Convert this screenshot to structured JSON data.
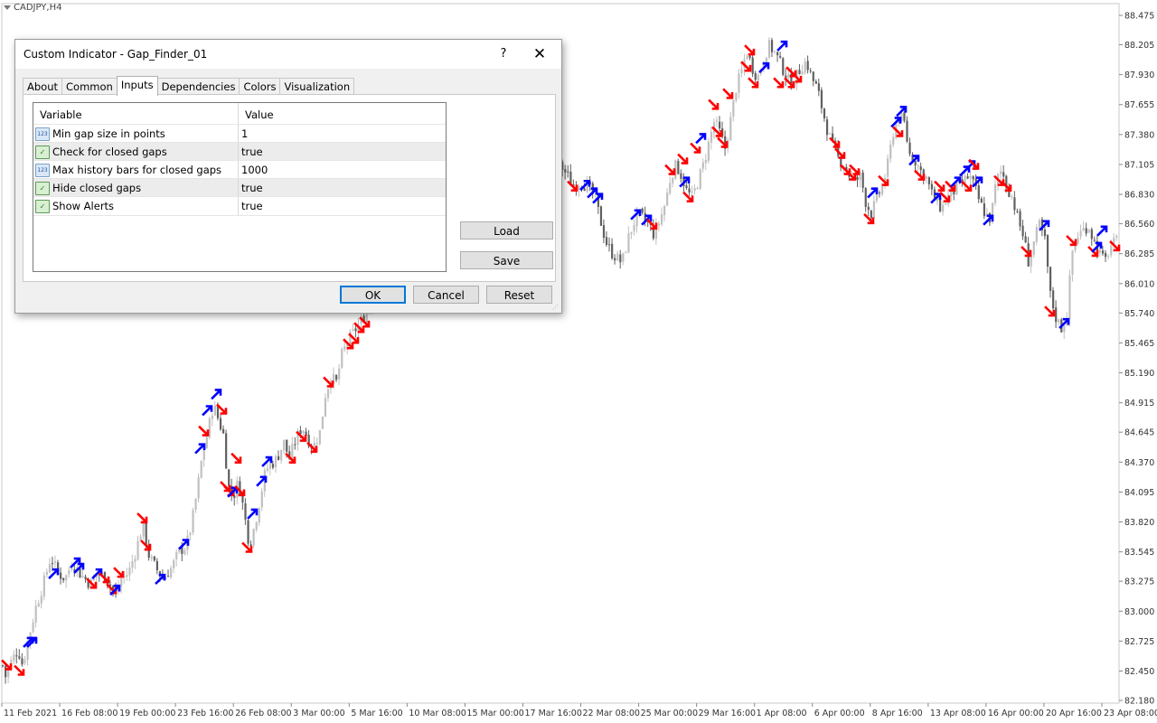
{
  "symbol": "CADJPY,H4",
  "dialog": {
    "title": "Custom Indicator - Gap_Finder_01",
    "help": "?",
    "close": "✕",
    "tabs": [
      {
        "label": "About",
        "active": false
      },
      {
        "label": "Common",
        "active": false
      },
      {
        "label": "Inputs",
        "active": true
      },
      {
        "label": "Dependencies",
        "active": false
      },
      {
        "label": "Colors",
        "active": false
      },
      {
        "label": "Visualization",
        "active": false
      }
    ],
    "table": {
      "headers": {
        "variable": "Variable",
        "value": "Value"
      },
      "rows": [
        {
          "icon": "integer-icon",
          "icon_text": "123",
          "name": "Min gap size in points",
          "value": "1"
        },
        {
          "icon": "boolean-icon",
          "icon_text": "✓",
          "name": "Check for closed gaps",
          "value": "true"
        },
        {
          "icon": "integer-icon",
          "icon_text": "123",
          "name": "Max history bars for closed gaps",
          "value": "1000"
        },
        {
          "icon": "boolean-icon",
          "icon_text": "✓",
          "name": "Hide closed gaps",
          "value": "true"
        },
        {
          "icon": "boolean-icon",
          "icon_text": "✓",
          "name": "Show Alerts",
          "value": "true"
        }
      ]
    },
    "load": "Load",
    "save": "Save",
    "ok": "OK",
    "cancel": "Cancel",
    "reset": "Reset"
  },
  "colors": {
    "up_arrow": "#0000ff",
    "down_arrow": "#ff0000",
    "bull_candle": "#c0c0c0",
    "bear_candle": "#606060",
    "grid": "#c8c8c8"
  },
  "chart_data": {
    "type": "candlestick",
    "symbol": "CADJPY",
    "timeframe": "H4",
    "y_ticks": [
      "88.475",
      "88.205",
      "87.930",
      "87.655",
      "87.380",
      "87.105",
      "86.830",
      "86.560",
      "86.285",
      "86.010",
      "85.740",
      "85.465",
      "85.190",
      "84.915",
      "84.645",
      "84.370",
      "84.095",
      "83.820",
      "83.545",
      "83.275",
      "83.000",
      "82.725",
      "82.450",
      "82.180"
    ],
    "x_ticks": [
      "11 Feb 2021",
      "16 Feb 08:00",
      "19 Feb 00:00",
      "23 Feb 16:00",
      "26 Feb 08:00",
      "3 Mar 00:00",
      "5 Mar 16:00",
      "10 Mar 08:00",
      "15 Mar 00:00",
      "17 Mar 16:00",
      "22 Mar 08:00",
      "25 Mar 00:00",
      "29 Mar 16:00",
      "1 Apr 08:00",
      "6 Apr 00:00",
      "8 Apr 16:00",
      "13 Apr 08:00",
      "16 Apr 00:00",
      "20 Apr 16:00",
      "23 Apr 08:00"
    ],
    "ylim": [
      82.18,
      88.475
    ],
    "price_path": [
      [
        0,
        82.6
      ],
      [
        6,
        82.4
      ],
      [
        13,
        82.55
      ],
      [
        20,
        82.65
      ],
      [
        25,
        82.5
      ],
      [
        30,
        82.7
      ],
      [
        40,
        83.05
      ],
      [
        48,
        83.25
      ],
      [
        56,
        83.5
      ],
      [
        64,
        83.35
      ],
      [
        72,
        83.3
      ],
      [
        80,
        83.45
      ],
      [
        88,
        83.35
      ],
      [
        100,
        83.25
      ],
      [
        108,
        83.35
      ],
      [
        118,
        83.3
      ],
      [
        128,
        83.15
      ],
      [
        134,
        83.3
      ],
      [
        142,
        83.35
      ],
      [
        150,
        83.55
      ],
      [
        158,
        83.8
      ],
      [
        165,
        83.5
      ],
      [
        172,
        83.4
      ],
      [
        180,
        83.3
      ],
      [
        190,
        83.4
      ],
      [
        198,
        83.55
      ],
      [
        206,
        83.6
      ],
      [
        212,
        83.8
      ],
      [
        218,
        84.1
      ],
      [
        224,
        84.45
      ],
      [
        230,
        84.65
      ],
      [
        236,
        84.9
      ],
      [
        242,
        84.75
      ],
      [
        248,
        84.6
      ],
      [
        252,
        84.15
      ],
      [
        258,
        84.05
      ],
      [
        264,
        84.2
      ],
      [
        270,
        83.9
      ],
      [
        276,
        83.6
      ],
      [
        282,
        83.8
      ],
      [
        288,
        84.05
      ],
      [
        294,
        84.3
      ],
      [
        300,
        84.35
      ],
      [
        306,
        84.4
      ],
      [
        314,
        84.55
      ],
      [
        320,
        84.4
      ],
      [
        326,
        84.55
      ],
      [
        334,
        84.7
      ],
      [
        340,
        84.6
      ],
      [
        346,
        84.5
      ],
      [
        354,
        84.65
      ],
      [
        360,
        85.0
      ],
      [
        366,
        85.15
      ],
      [
        372,
        85.1
      ],
      [
        378,
        85.35
      ],
      [
        386,
        85.5
      ],
      [
        394,
        85.6
      ],
      [
        402,
        85.7
      ],
      [
        410,
        85.8
      ],
      [
        420,
        86.0
      ],
      [
        430,
        86.2
      ],
      [
        440,
        86.35
      ],
      [
        450,
        86.4
      ],
      [
        460,
        86.2
      ],
      [
        470,
        86.4
      ],
      [
        480,
        86.55
      ],
      [
        490,
        86.7
      ],
      [
        500,
        86.85
      ],
      [
        510,
        86.95
      ],
      [
        520,
        86.75
      ],
      [
        530,
        86.9
      ],
      [
        540,
        86.8
      ],
      [
        550,
        86.95
      ],
      [
        560,
        86.7
      ],
      [
        570,
        86.85
      ],
      [
        580,
        86.9
      ],
      [
        590,
        87.0
      ],
      [
        600,
        86.95
      ],
      [
        610,
        87.05
      ],
      [
        620,
        87.1
      ],
      [
        628,
        87.0
      ],
      [
        634,
        86.9
      ],
      [
        642,
        86.95
      ],
      [
        650,
        86.9
      ],
      [
        658,
        86.8
      ],
      [
        664,
        86.6
      ],
      [
        670,
        86.4
      ],
      [
        676,
        86.3
      ],
      [
        682,
        86.25
      ],
      [
        688,
        86.2
      ],
      [
        694,
        86.4
      ],
      [
        700,
        86.55
      ],
      [
        706,
        86.65
      ],
      [
        712,
        86.6
      ],
      [
        718,
        86.55
      ],
      [
        724,
        86.45
      ],
      [
        730,
        86.6
      ],
      [
        736,
        86.75
      ],
      [
        742,
        87.0
      ],
      [
        748,
        87.1
      ],
      [
        754,
        87.0
      ],
      [
        760,
        86.85
      ],
      [
        766,
        86.8
      ],
      [
        772,
        86.95
      ],
      [
        778,
        87.1
      ],
      [
        784,
        87.3
      ],
      [
        790,
        87.5
      ],
      [
        796,
        87.4
      ],
      [
        802,
        87.25
      ],
      [
        808,
        87.5
      ],
      [
        814,
        87.8
      ],
      [
        820,
        87.95
      ],
      [
        826,
        88.15
      ],
      [
        832,
        88.0
      ],
      [
        838,
        87.9
      ],
      [
        844,
        88.05
      ],
      [
        850,
        88.2
      ],
      [
        856,
        88.15
      ],
      [
        862,
        88.05
      ],
      [
        868,
        87.95
      ],
      [
        874,
        87.85
      ],
      [
        880,
        87.9
      ],
      [
        886,
        88.0
      ],
      [
        892,
        88.05
      ],
      [
        898,
        87.9
      ],
      [
        904,
        87.8
      ],
      [
        910,
        87.6
      ],
      [
        916,
        87.4
      ],
      [
        922,
        87.25
      ],
      [
        928,
        87.15
      ],
      [
        934,
        87.1
      ],
      [
        940,
        87.0
      ],
      [
        946,
        86.95
      ],
      [
        952,
        87.0
      ],
      [
        958,
        86.75
      ],
      [
        964,
        86.65
      ],
      [
        970,
        86.8
      ],
      [
        976,
        86.9
      ],
      [
        982,
        87.1
      ],
      [
        988,
        87.4
      ],
      [
        994,
        87.55
      ],
      [
        1000,
        87.5
      ],
      [
        1006,
        87.2
      ],
      [
        1012,
        87.15
      ],
      [
        1018,
        87.05
      ],
      [
        1024,
        87.0
      ],
      [
        1030,
        86.85
      ],
      [
        1036,
        86.75
      ],
      [
        1042,
        86.7
      ],
      [
        1048,
        86.8
      ],
      [
        1054,
        86.85
      ],
      [
        1060,
        86.9
      ],
      [
        1066,
        86.95
      ],
      [
        1072,
        87.0
      ],
      [
        1078,
        86.9
      ],
      [
        1084,
        86.75
      ],
      [
        1090,
        86.65
      ],
      [
        1096,
        86.6
      ],
      [
        1102,
        86.95
      ],
      [
        1108,
        87.05
      ],
      [
        1114,
        86.9
      ],
      [
        1120,
        86.8
      ],
      [
        1126,
        86.6
      ],
      [
        1132,
        86.45
      ],
      [
        1138,
        86.2
      ],
      [
        1144,
        86.4
      ],
      [
        1150,
        86.55
      ],
      [
        1156,
        86.4
      ],
      [
        1162,
        85.9
      ],
      [
        1168,
        85.7
      ],
      [
        1174,
        85.6
      ],
      [
        1180,
        85.7
      ],
      [
        1186,
        86.3
      ],
      [
        1192,
        86.45
      ],
      [
        1198,
        86.5
      ],
      [
        1204,
        86.55
      ],
      [
        1210,
        86.4
      ],
      [
        1216,
        86.3
      ],
      [
        1222,
        86.2
      ],
      [
        1228,
        86.35
      ],
      [
        1236,
        86.4
      ]
    ],
    "arrows": [
      {
        "dir": "down",
        "x": 8,
        "p": 82.5
      },
      {
        "dir": "down",
        "x": 22,
        "p": 82.45
      },
      {
        "dir": "up",
        "x": 32,
        "p": 82.72
      },
      {
        "dir": "up",
        "x": 36,
        "p": 82.72
      },
      {
        "dir": "up",
        "x": 60,
        "p": 83.35
      },
      {
        "dir": "up",
        "x": 84,
        "p": 83.45
      },
      {
        "dir": "up",
        "x": 88,
        "p": 83.4
      },
      {
        "dir": "down",
        "x": 102,
        "p": 83.25
      },
      {
        "dir": "up",
        "x": 108,
        "p": 83.35
      },
      {
        "dir": "down",
        "x": 116,
        "p": 83.3
      },
      {
        "dir": "down",
        "x": 124,
        "p": 83.2
      },
      {
        "dir": "up",
        "x": 128,
        "p": 83.2
      },
      {
        "dir": "down",
        "x": 132,
        "p": 83.35
      },
      {
        "dir": "down",
        "x": 158,
        "p": 83.85
      },
      {
        "dir": "down",
        "x": 162,
        "p": 83.6
      },
      {
        "dir": "up",
        "x": 178,
        "p": 83.3
      },
      {
        "dir": "up",
        "x": 204,
        "p": 83.62
      },
      {
        "dir": "up",
        "x": 222,
        "p": 84.5
      },
      {
        "dir": "down",
        "x": 226,
        "p": 84.65
      },
      {
        "dir": "up",
        "x": 230,
        "p": 84.85
      },
      {
        "dir": "up",
        "x": 240,
        "p": 85.0
      },
      {
        "dir": "down",
        "x": 246,
        "p": 84.85
      },
      {
        "dir": "down",
        "x": 250,
        "p": 84.14
      },
      {
        "dir": "down",
        "x": 254,
        "p": 84.1
      },
      {
        "dir": "up",
        "x": 258,
        "p": 84.1
      },
      {
        "dir": "down",
        "x": 262,
        "p": 84.4
      },
      {
        "dir": "down",
        "x": 266,
        "p": 84.1
      },
      {
        "dir": "down",
        "x": 274,
        "p": 83.58
      },
      {
        "dir": "up",
        "x": 280,
        "p": 83.9
      },
      {
        "dir": "up",
        "x": 290,
        "p": 84.2
      },
      {
        "dir": "up",
        "x": 296,
        "p": 84.38
      },
      {
        "dir": "down",
        "x": 322,
        "p": 84.4
      },
      {
        "dir": "down",
        "x": 334,
        "p": 84.6
      },
      {
        "dir": "down",
        "x": 346,
        "p": 84.5
      },
      {
        "dir": "down",
        "x": 364,
        "p": 85.1
      },
      {
        "dir": "down",
        "x": 386,
        "p": 85.45
      },
      {
        "dir": "down",
        "x": 392,
        "p": 85.5
      },
      {
        "dir": "down",
        "x": 398,
        "p": 85.6
      },
      {
        "dir": "down",
        "x": 404,
        "p": 85.65
      },
      {
        "dir": "down",
        "x": 634,
        "p": 86.9
      },
      {
        "dir": "up",
        "x": 648,
        "p": 86.92
      },
      {
        "dir": "up",
        "x": 656,
        "p": 86.85
      },
      {
        "dir": "up",
        "x": 662,
        "p": 86.8
      },
      {
        "dir": "up",
        "x": 704,
        "p": 86.65
      },
      {
        "dir": "up",
        "x": 716,
        "p": 86.6
      },
      {
        "dir": "down",
        "x": 722,
        "p": 86.55
      },
      {
        "dir": "down",
        "x": 742,
        "p": 87.05
      },
      {
        "dir": "down",
        "x": 756,
        "p": 87.15
      },
      {
        "dir": "up",
        "x": 758,
        "p": 86.95
      },
      {
        "dir": "down",
        "x": 762,
        "p": 86.8
      },
      {
        "dir": "down",
        "x": 770,
        "p": 87.25
      },
      {
        "dir": "up",
        "x": 776,
        "p": 87.35
      },
      {
        "dir": "down",
        "x": 790,
        "p": 87.65
      },
      {
        "dir": "down",
        "x": 794,
        "p": 87.4
      },
      {
        "dir": "down",
        "x": 800,
        "p": 87.3
      },
      {
        "dir": "down",
        "x": 806,
        "p": 87.75
      },
      {
        "dir": "down",
        "x": 826,
        "p": 88.0
      },
      {
        "dir": "down",
        "x": 830,
        "p": 88.15
      },
      {
        "dir": "up",
        "x": 846,
        "p": 88.0
      },
      {
        "dir": "down",
        "x": 834,
        "p": 87.85
      },
      {
        "dir": "up",
        "x": 866,
        "p": 88.2
      },
      {
        "dir": "down",
        "x": 862,
        "p": 87.85
      },
      {
        "dir": "down",
        "x": 876,
        "p": 87.95
      },
      {
        "dir": "down",
        "x": 874,
        "p": 87.85
      },
      {
        "dir": "down",
        "x": 882,
        "p": 87.9
      },
      {
        "dir": "down",
        "x": 924,
        "p": 87.3
      },
      {
        "dir": "down",
        "x": 930,
        "p": 87.2
      },
      {
        "dir": "down",
        "x": 936,
        "p": 87.05
      },
      {
        "dir": "down",
        "x": 942,
        "p": 87.0
      },
      {
        "dir": "down",
        "x": 946,
        "p": 87.05
      },
      {
        "dir": "down",
        "x": 962,
        "p": 86.6
      },
      {
        "dir": "up",
        "x": 966,
        "p": 86.85
      },
      {
        "dir": "down",
        "x": 978,
        "p": 86.95
      },
      {
        "dir": "up",
        "x": 992,
        "p": 87.5
      },
      {
        "dir": "up",
        "x": 998,
        "p": 87.6
      },
      {
        "dir": "down",
        "x": 994,
        "p": 87.4
      },
      {
        "dir": "up",
        "x": 1012,
        "p": 87.15
      },
      {
        "dir": "down",
        "x": 1018,
        "p": 87.0
      },
      {
        "dir": "up",
        "x": 1036,
        "p": 86.8
      },
      {
        "dir": "down",
        "x": 1040,
        "p": 86.9
      },
      {
        "dir": "down",
        "x": 1046,
        "p": 86.8
      },
      {
        "dir": "down",
        "x": 1052,
        "p": 86.9
      },
      {
        "dir": "up",
        "x": 1058,
        "p": 86.95
      },
      {
        "dir": "up",
        "x": 1068,
        "p": 87.05
      },
      {
        "dir": "up",
        "x": 1074,
        "p": 87.1
      },
      {
        "dir": "down",
        "x": 1070,
        "p": 86.9
      },
      {
        "dir": "down",
        "x": 1078,
        "p": 87.1
      },
      {
        "dir": "up",
        "x": 1082,
        "p": 86.95
      },
      {
        "dir": "up",
        "x": 1094,
        "p": 86.6
      },
      {
        "dir": "down",
        "x": 1106,
        "p": 86.95
      },
      {
        "dir": "down",
        "x": 1114,
        "p": 86.9
      },
      {
        "dir": "down",
        "x": 1136,
        "p": 86.3
      },
      {
        "dir": "up",
        "x": 1156,
        "p": 86.55
      },
      {
        "dir": "down",
        "x": 1162,
        "p": 85.75
      },
      {
        "dir": "up",
        "x": 1178,
        "p": 85.65
      },
      {
        "dir": "down",
        "x": 1186,
        "p": 86.4
      },
      {
        "dir": "down",
        "x": 1210,
        "p": 86.3
      },
      {
        "dir": "up",
        "x": 1214,
        "p": 86.35
      },
      {
        "dir": "up",
        "x": 1220,
        "p": 86.5
      },
      {
        "dir": "down",
        "x": 1234,
        "p": 86.35
      }
    ]
  }
}
